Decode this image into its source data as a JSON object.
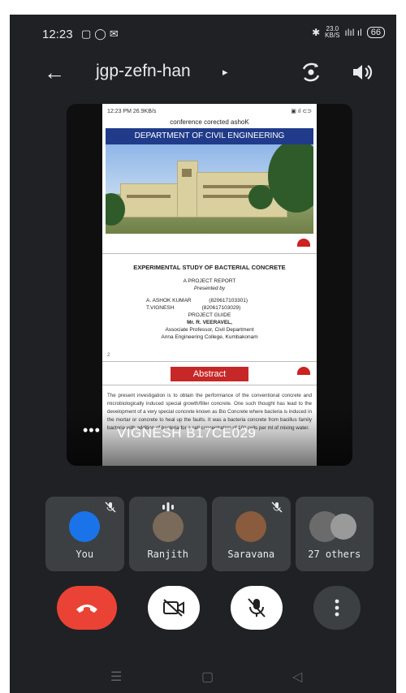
{
  "status_bar": {
    "time": "12:23",
    "left_icons": [
      "screen-record-icon",
      "whatsapp-icon",
      "gmail-icon"
    ],
    "net_speed": "23.0",
    "net_unit": "KB/S",
    "right_text": "ılıl ıl",
    "battery": "66"
  },
  "top_bar": {
    "meeting_code": "jgp-zefn-han",
    "caret": "▸"
  },
  "shared_screen": {
    "doc_status_left": "12:23 PM  26.9KB/s",
    "banner": "conference corected  ashoK",
    "department": "DEPARTMENT OF CIVIL ENGINEERING",
    "project_title": "EXPERIMENTAL STUDY OF BACTERIAL CONCRETE",
    "report_label": "A PROJECT REPORT",
    "presented_by": "Presented by",
    "student1": "A. ASHOK KUMAR",
    "student1_id": "(820617103301)",
    "student2": "T.VIGNESH",
    "student2_id": "(820617103029)",
    "guide_label": "PROJECT GUIDE",
    "guide": "Mr. R. VEERAVEL,",
    "guide_role": "Associate Professor, Civil Department",
    "college": "Anna Engineering College, Kumbakonam",
    "slide_num": "2",
    "abstract_title": "Abstract",
    "abstract_text": "The present investigation is to obtain the performance of the conventional concrete and microbiologically induced special growth/filler concrete. One such thought has lead to the development of a very special concrete known as Bio Concrete where bacteria is induced in the mortar or concrete to heal up the faults. It was a bacteria concrete from bacillus family bacteria with addition of bacteria for a cell concentration of 10^ cells per ml of mixing water.",
    "presenter": "VIGNESH B17CE029",
    "more": "•••"
  },
  "participants": [
    {
      "name": "You",
      "muted": true,
      "avatar_color": "#1a73e8"
    },
    {
      "name": "Ranjith",
      "speaking": true,
      "avatar_color": "#7a6a5a"
    },
    {
      "name": "Saravana",
      "muted": true,
      "avatar_color": "#8a5b3c"
    },
    {
      "name": "27 others",
      "avatar_color": "#6b6b6b"
    }
  ],
  "colors": {
    "background": "#202124",
    "tile": "#3c4043",
    "end_call": "#ea4335"
  }
}
